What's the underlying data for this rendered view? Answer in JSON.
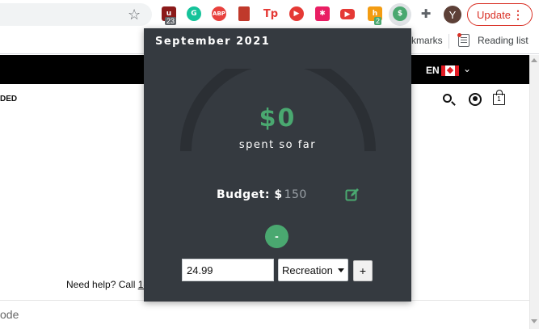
{
  "browser": {
    "bookmarks_partial": "kmarks",
    "reading_list": "Reading list",
    "update_label": "Update",
    "avatar_initial": "Y",
    "extensions": [
      {
        "name": "ublock-icon",
        "color": "#8b1a1a",
        "badge": "23"
      },
      {
        "name": "grammarly-icon",
        "color": "#15c39a"
      },
      {
        "name": "adblock-plus-icon",
        "color": "#e8413d"
      },
      {
        "name": "book-icon",
        "color": "#c0392b"
      },
      {
        "name": "tp-icon",
        "color": "#e53935"
      },
      {
        "name": "play-icon",
        "color": "#e53935"
      },
      {
        "name": "calendar-icon",
        "color": "#e91e63"
      },
      {
        "name": "youtube-icon",
        "color": "#e53935"
      },
      {
        "name": "honey-icon",
        "color": "#f39c12",
        "badge": "2"
      },
      {
        "name": "budget-extension-icon",
        "color": "#4aa870"
      }
    ]
  },
  "page": {
    "lang": "EN",
    "heading_fragment": "DED",
    "help_text": "Need help? Call ",
    "help_link": "1-",
    "cart_count": "1",
    "bottom_fragment": "ode"
  },
  "popup": {
    "month": "September 2021",
    "spent_amount": "$0",
    "spent_label": "spent so far",
    "budget_label": "Budget: $",
    "budget_value": "150",
    "minus_label": "-",
    "amount_value": "24.99",
    "category_selected": "Recreation",
    "plus_label": "+",
    "gauge_fraction": 0,
    "accent_color": "#4aa870"
  }
}
